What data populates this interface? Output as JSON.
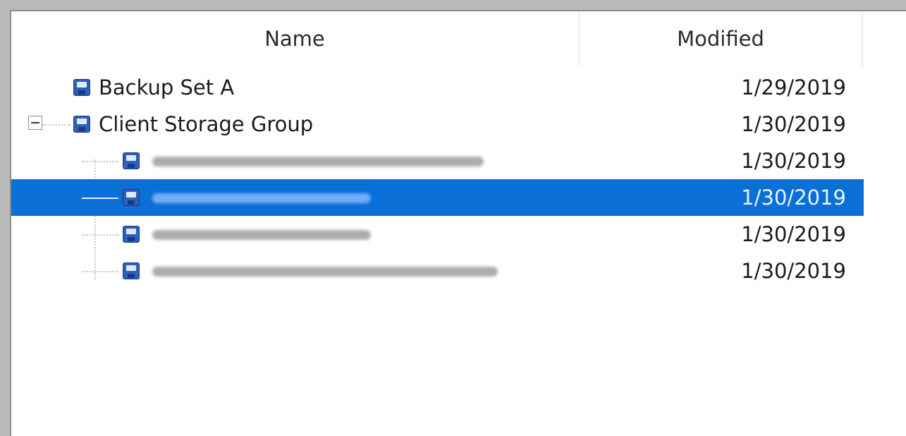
{
  "columns": {
    "name": "Name",
    "modified": "Modified"
  },
  "rows": [
    {
      "label": "Backup Set A",
      "date": "1/29/2019",
      "icon": "disk-icon",
      "selected": false,
      "redacted": false
    },
    {
      "label": "Client Storage Group",
      "date": "1/30/2019",
      "icon": "disk-icon",
      "selected": false,
      "redacted": false,
      "expanded": true
    },
    {
      "label": "",
      "date": "1/30/2019",
      "icon": "disk-icon",
      "selected": false,
      "redacted": true
    },
    {
      "label": "",
      "date": "1/30/2019",
      "icon": "disk-icon",
      "selected": true,
      "redacted": true
    },
    {
      "label": "",
      "date": "1/30/2019",
      "icon": "disk-icon",
      "selected": false,
      "redacted": true
    },
    {
      "label": "",
      "date": "1/30/2019",
      "icon": "disk-icon",
      "selected": false,
      "redacted": true
    }
  ],
  "colors": {
    "selection": "#0a6fd6",
    "icon": "#2f5fb8"
  }
}
